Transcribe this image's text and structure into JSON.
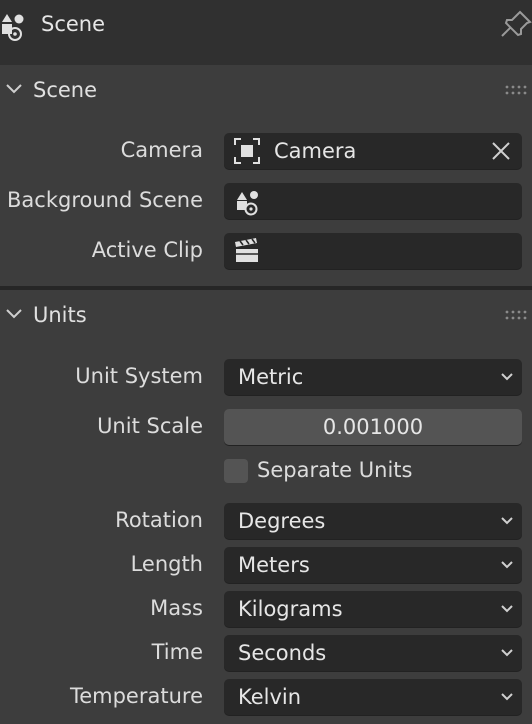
{
  "header": {
    "title": "Scene",
    "icon": "scene-icon",
    "pin_icon": "pin-icon"
  },
  "scene_panel": {
    "title": "Scene",
    "camera": {
      "label": "Camera",
      "value": "Camera",
      "icon": "camera-object-icon"
    },
    "background_scene": {
      "label": "Background Scene",
      "value": "",
      "icon": "scene-icon"
    },
    "active_clip": {
      "label": "Active Clip",
      "value": "",
      "icon": "clip-icon"
    }
  },
  "units_panel": {
    "title": "Units",
    "unit_system": {
      "label": "Unit System",
      "value": "Metric"
    },
    "unit_scale": {
      "label": "Unit Scale",
      "value": "0.001000"
    },
    "separate_units": {
      "label": "Separate Units",
      "checked": false
    },
    "rotation": {
      "label": "Rotation",
      "value": "Degrees"
    },
    "length": {
      "label": "Length",
      "value": "Meters"
    },
    "mass": {
      "label": "Mass",
      "value": "Kilograms"
    },
    "time": {
      "label": "Time",
      "value": "Seconds"
    },
    "temperature": {
      "label": "Temperature",
      "value": "Kelvin"
    }
  },
  "colors": {
    "panel_bg": "#3d3d3d",
    "field_bg": "#282828",
    "numeric_bg": "#545454",
    "text": "#dcdcdc"
  }
}
